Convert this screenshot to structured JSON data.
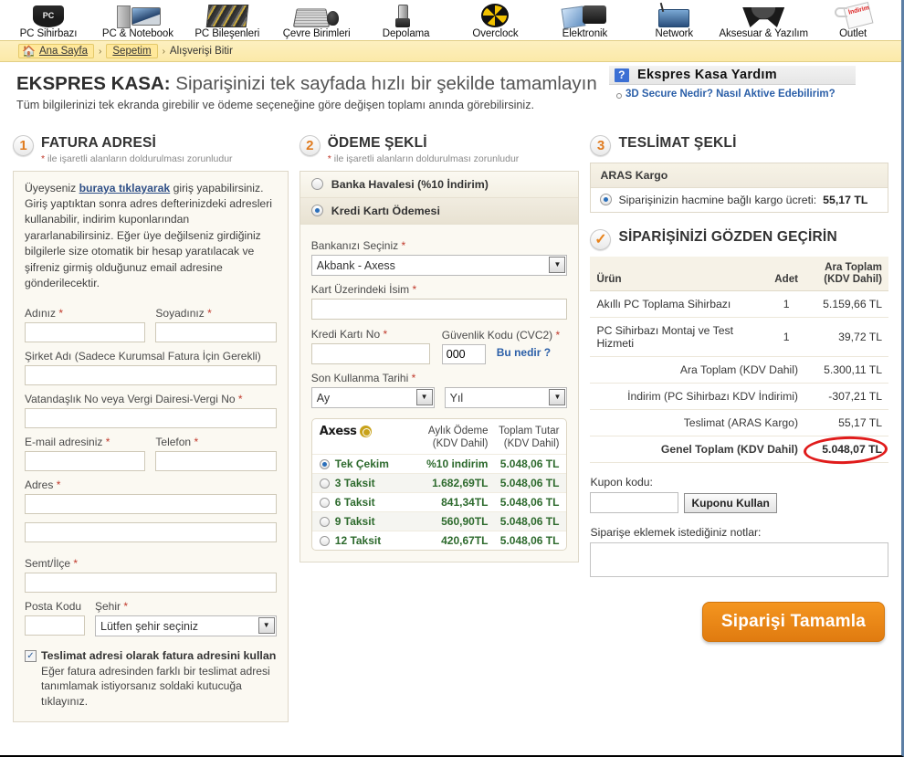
{
  "nav": {
    "items": [
      {
        "label": "PC Sihirbazı",
        "icon": "pc-wizard-icon"
      },
      {
        "label": "PC & Notebook",
        "icon": "notebook-icon"
      },
      {
        "label": "PC Bileşenleri",
        "icon": "components-icon"
      },
      {
        "label": "Çevre Birimleri",
        "icon": "peripherals-icon"
      },
      {
        "label": "Depolama",
        "icon": "storage-icon"
      },
      {
        "label": "Overclock",
        "icon": "fan-icon"
      },
      {
        "label": "Elektronik",
        "icon": "electronics-icon"
      },
      {
        "label": "Network",
        "icon": "router-icon"
      },
      {
        "label": "Aksesuar & Yazılım",
        "icon": "accessory-icon"
      },
      {
        "label": "Outlet",
        "icon": "outlet-tag-icon"
      }
    ]
  },
  "breadcrumb": {
    "home": "Ana Sayfa",
    "cart": "Sepetim",
    "current": "Alışverişi Bitir",
    "separator": "›"
  },
  "heading": {
    "title_bold": "EKSPRES KASA:",
    "title_rest": " Siparişinizi tek sayfada hızlı bir şekilde tamamlayın",
    "subtitle": "Tüm bilgilerinizi tek ekranda girebilir ve ödeme seçeneğine göre değişen toplamı anında görebilirsiniz."
  },
  "help": {
    "title": "Ekspres Kasa Yardım",
    "link": "3D Secure Nedir? Nasıl Aktive Edebilirim?"
  },
  "billing": {
    "step": "1",
    "title": "FATURA ADRESİ",
    "required_note_star": "*",
    "required_note": " ile işaretli alanların doldurulması zorunludur",
    "info_1": "Üyeyseniz ",
    "info_link": "buraya tıklayarak",
    "info_2": " giriş yapabilirsiniz. Giriş yaptıktan sonra adres defterinizdeki adresleri kullanabilir, indirim kuponlarından yararlanabilirsiniz. Eğer üye değilseniz girdiğiniz bilgilerle size otomatik bir hesap yaratılacak ve şifreniz girmiş olduğunuz email adresine gönderilecektir.",
    "fields": {
      "first_name": "Adınız",
      "last_name": "Soyadınız",
      "company": "Şirket Adı (Sadece Kurumsal Fatura İçin Gerekli)",
      "tax_id": "Vatandaşlık No veya Vergi Dairesi-Vergi No",
      "email": "E-mail adresiniz",
      "phone": "Telefon",
      "address": "Adres",
      "district": "Semt/İlçe",
      "postal_code": "Posta Kodu",
      "city": "Şehir",
      "city_value": "Lütfen şehir seçiniz"
    },
    "checkbox_label": "Teslimat adresi olarak fatura adresini kullan",
    "checkbox_desc": "Eğer fatura adresinden farklı bir teslimat adresi tanımlamak istiyorsanız soldaki kutucuğa tıklayınız.",
    "checkbox_checked": true
  },
  "payment": {
    "step": "2",
    "title": "ÖDEME ŞEKLİ",
    "required_note_star": "*",
    "required_note": " ile işaretli alanların doldurulması zorunludur",
    "options": [
      {
        "label": "Banka Havalesi (%10 İndirim)",
        "selected": false
      },
      {
        "label": "Kredi Kartı Ödemesi",
        "selected": true
      }
    ],
    "bank_label": "Bankanızı Seçiniz",
    "bank_value": "Akbank - Axess",
    "card_name_label": "Kart Üzerindeki İsim",
    "card_name_value": "",
    "card_no_label": "Kredi Kartı No",
    "card_no_value": "",
    "cvc_label": "Güvenlik Kodu (CVC2)",
    "cvc_value": "000",
    "whatis": "Bu nedir ?",
    "expiry_label": "Son Kullanma Tarihi",
    "month_value": "Ay",
    "year_value": "Yıl",
    "installments": {
      "brand": "Axess",
      "col_monthly_1": "Aylık Ödeme",
      "col_monthly_2": "(KDV Dahil)",
      "col_total_1": "Toplam Tutar",
      "col_total_2": "(KDV Dahil)",
      "rows": [
        {
          "name": "Tek Çekim",
          "monthly": "%10 indirim",
          "total": "5.048,06 TL",
          "selected": true
        },
        {
          "name": "3 Taksit",
          "monthly": "1.682,69TL",
          "total": "5.048,06 TL",
          "selected": false
        },
        {
          "name": "6 Taksit",
          "monthly": "841,34TL",
          "total": "5.048,06 TL",
          "selected": false
        },
        {
          "name": "9 Taksit",
          "monthly": "560,90TL",
          "total": "5.048,06 TL",
          "selected": false
        },
        {
          "name": "12 Taksit",
          "monthly": "420,67TL",
          "total": "5.048,06 TL",
          "selected": false
        }
      ]
    }
  },
  "shipping": {
    "step": "3",
    "title": "TESLİMAT ŞEKLİ",
    "carrier": "ARAS Kargo",
    "option_text": "Siparişinizin hacmine bağlı kargo ücreti: ",
    "option_price": "55,17 TL",
    "option_selected": true
  },
  "review": {
    "title": "SİPARİŞİNİZİ GÖZDEN GEÇİRİN",
    "headers": {
      "product": "Ürün",
      "qty": "Adet",
      "subtotal_1": "Ara Toplam",
      "subtotal_2": "(KDV Dahil)"
    },
    "items": [
      {
        "product": "Akıllı PC Toplama Sihirbazı",
        "qty": "1",
        "amount": "5.159,66 TL"
      },
      {
        "product": "PC Sihirbazı Montaj ve Test Hizmeti",
        "qty": "1",
        "amount": "39,72 TL"
      }
    ],
    "totals": [
      {
        "label": "Ara Toplam (KDV Dahil)",
        "amount": "5.300,11 TL"
      },
      {
        "label": "İndirim (PC Sihirbazı KDV İndirimi)",
        "amount": "-307,21 TL"
      },
      {
        "label": "Teslimat (ARAS Kargo)",
        "amount": "55,17 TL"
      }
    ],
    "grand": {
      "label": "Genel Toplam (KDV Dahil)",
      "amount": "5.048,07 TL",
      "highlight_color": "#e01b1b"
    },
    "coupon_label": "Kupon kodu:",
    "coupon_value": "",
    "coupon_button": "Kuponu Kullan",
    "notes_label": "Siparişe eklemek istediğiniz notlar:",
    "notes_value": "",
    "finish_button": "Siparişi Tamamla"
  }
}
